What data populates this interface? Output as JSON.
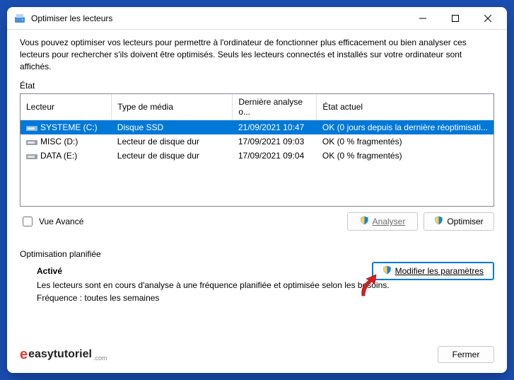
{
  "window": {
    "title": "Optimiser les lecteurs"
  },
  "description": "Vous pouvez optimiser vos lecteurs pour permettre à l'ordinateur de fonctionner plus efficacement ou bien analyser ces lecteurs pour rechercher s'ils doivent être optimisés. Seuls les lecteurs connectés et installés sur votre ordinateur sont affichés.",
  "state_label": "État",
  "columns": {
    "c0": "Lecteur",
    "c1": "Type de média",
    "c2": "Dernière analyse o...",
    "c3": "État actuel"
  },
  "rows": [
    {
      "name": "SYSTEME (C:)",
      "type": "Disque SSD",
      "last": "21/09/2021 10:47",
      "status": "OK (0 jours depuis la dernière réoptimisati...",
      "selected": true,
      "icon": "ssd"
    },
    {
      "name": "MISC (D:)",
      "type": "Lecteur de disque dur",
      "last": "17/09/2021 09:03",
      "status": "OK (0 % fragmentés)",
      "selected": false,
      "icon": "hdd"
    },
    {
      "name": "DATA (E:)",
      "type": "Lecteur de disque dur",
      "last": "17/09/2021 09:04",
      "status": "OK (0 % fragmentés)",
      "selected": false,
      "icon": "hdd"
    }
  ],
  "advanced_label": "Vue Avancé",
  "buttons": {
    "analyze": "Analyser",
    "optimize": "Optimiser",
    "modify": "Modifier les paramètres",
    "close": "Fermer"
  },
  "sched": {
    "heading": "Optimisation planifiée",
    "status": "Activé",
    "line1": "Les lecteurs sont en cours d'analyse à une fréquence planifiée et optimisée selon les besoins.",
    "line2": "Fréquence : toutes les semaines"
  },
  "brand": {
    "prefix": "e",
    "name": "easytutoriel",
    "suffix": ".com"
  }
}
